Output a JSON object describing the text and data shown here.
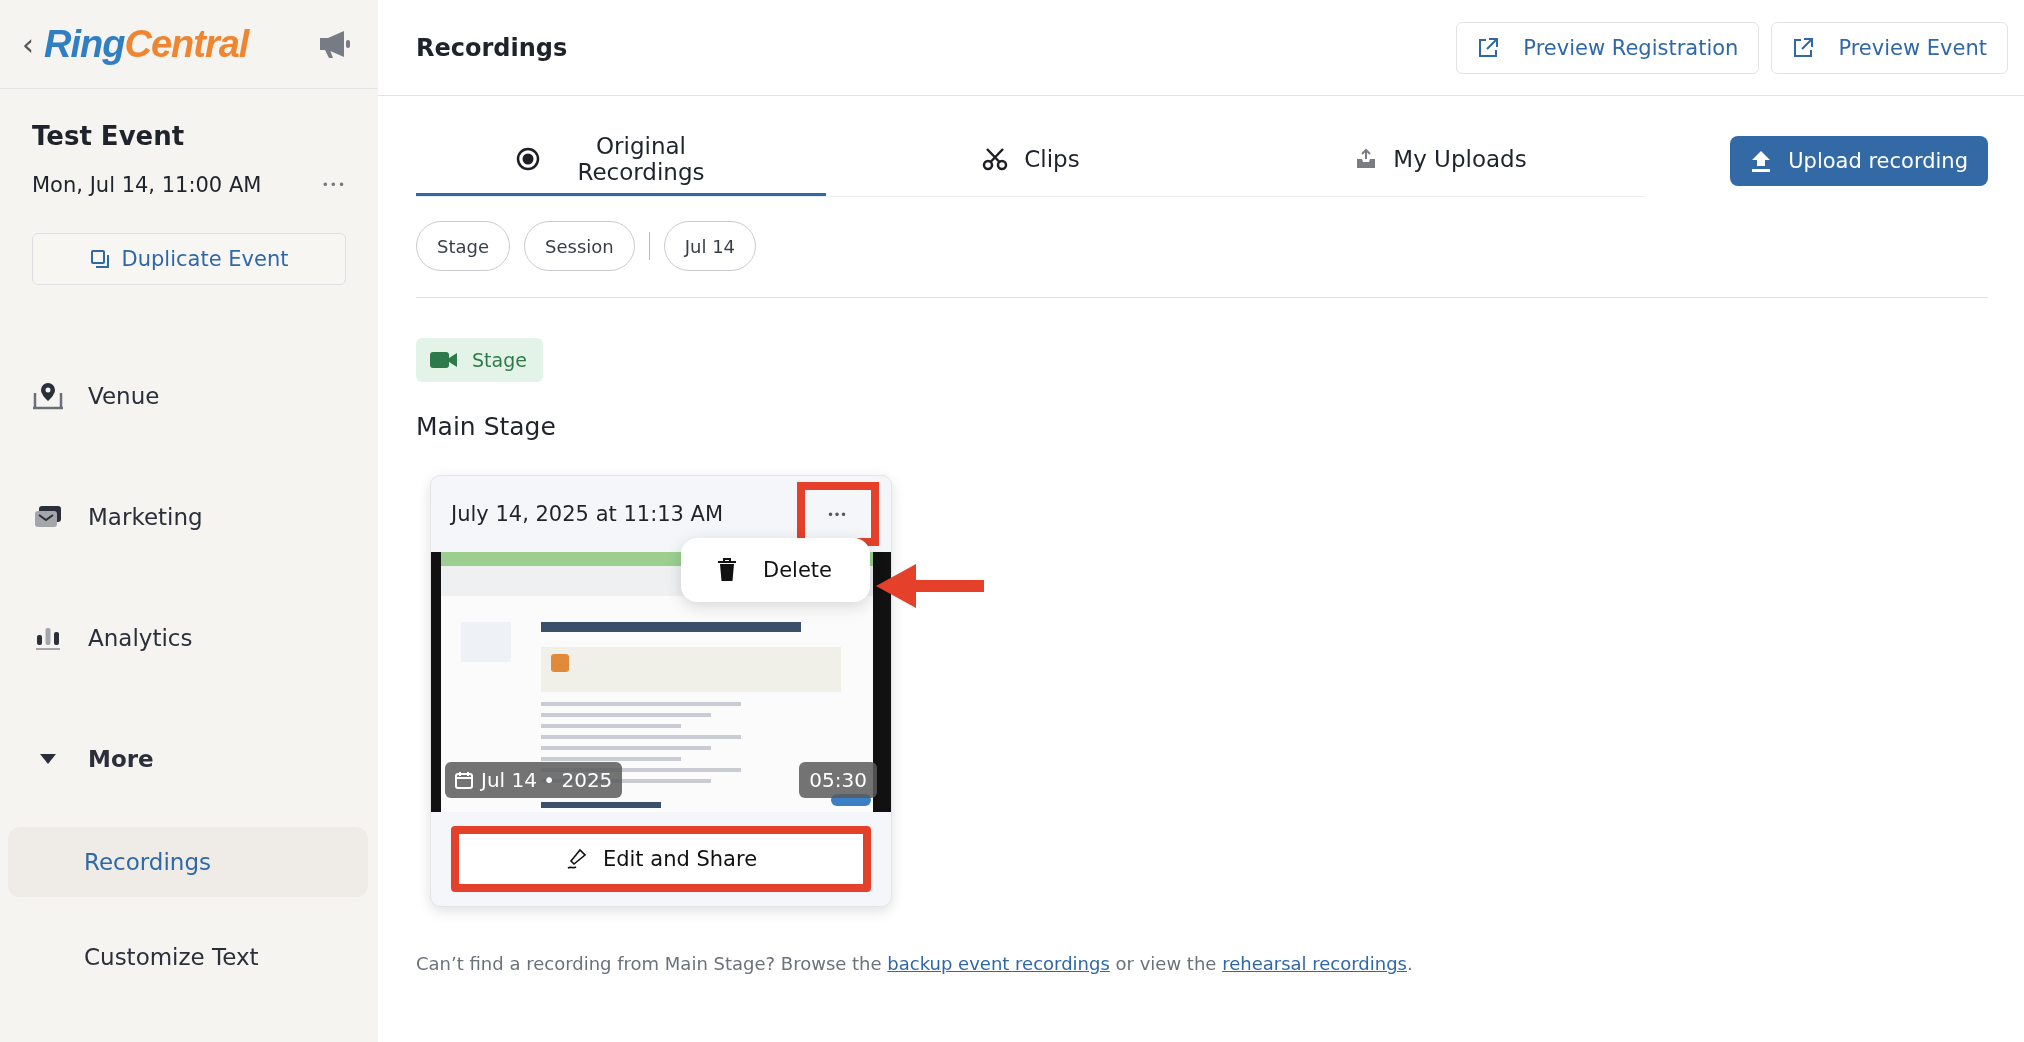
{
  "sidebar": {
    "back": "‹",
    "logo": [
      {
        "text": "Ring",
        "color": "#2f7fc2"
      },
      {
        "text": "Central",
        "color": "#ef8531"
      }
    ],
    "event": {
      "title": "Test Event",
      "date": "Mon, Jul 14, 11:00 AM",
      "more": "•••",
      "duplicate": "Duplicate Event"
    },
    "items": [
      {
        "label": "Venue",
        "kind": "venue",
        "selected": false
      },
      {
        "label": "Marketing",
        "kind": "marketing",
        "selected": false
      },
      {
        "label": "Analytics",
        "kind": "analytics",
        "selected": false
      },
      {
        "label": "More",
        "kind": "group",
        "expanded": true,
        "selected": false,
        "children": [
          {
            "label": "Recordings",
            "selected": true
          },
          {
            "label": "Customize Text",
            "selected": false
          }
        ]
      }
    ]
  },
  "header": {
    "title": "Recordings",
    "buttons": [
      "Preview Registration",
      "Preview Event"
    ]
  },
  "tabs": [
    {
      "label": "Original Recordings",
      "kind": "original",
      "selected": true
    },
    {
      "label": "Clips",
      "kind": "clips",
      "selected": false
    },
    {
      "label": "My Uploads",
      "kind": "uploads",
      "selected": false
    }
  ],
  "upload_button": "Upload recording",
  "filters": [
    {
      "label": "Stage",
      "kind": "type"
    },
    {
      "label": "Session",
      "kind": "type"
    },
    {
      "label": "Jul 14",
      "kind": "date"
    }
  ],
  "section": {
    "badge": "Stage",
    "title": "Main Stage"
  },
  "recording": {
    "timestamp": "July 14, 2025 at 11:13 AM",
    "more": "•••",
    "more_highlighted": true,
    "date": "Jul 14 • 2025",
    "duration": "05:30",
    "menu": [
      {
        "label": "Delete",
        "pointed": true
      }
    ],
    "action": "Edit and Share",
    "action_highlighted": true
  },
  "footer": {
    "before": "Can’t find a recording from Main Stage? Browse the",
    "link_1": "backup event recordings",
    "middle": "or view the",
    "link_2": "rehearsal recordings",
    "after": "."
  }
}
